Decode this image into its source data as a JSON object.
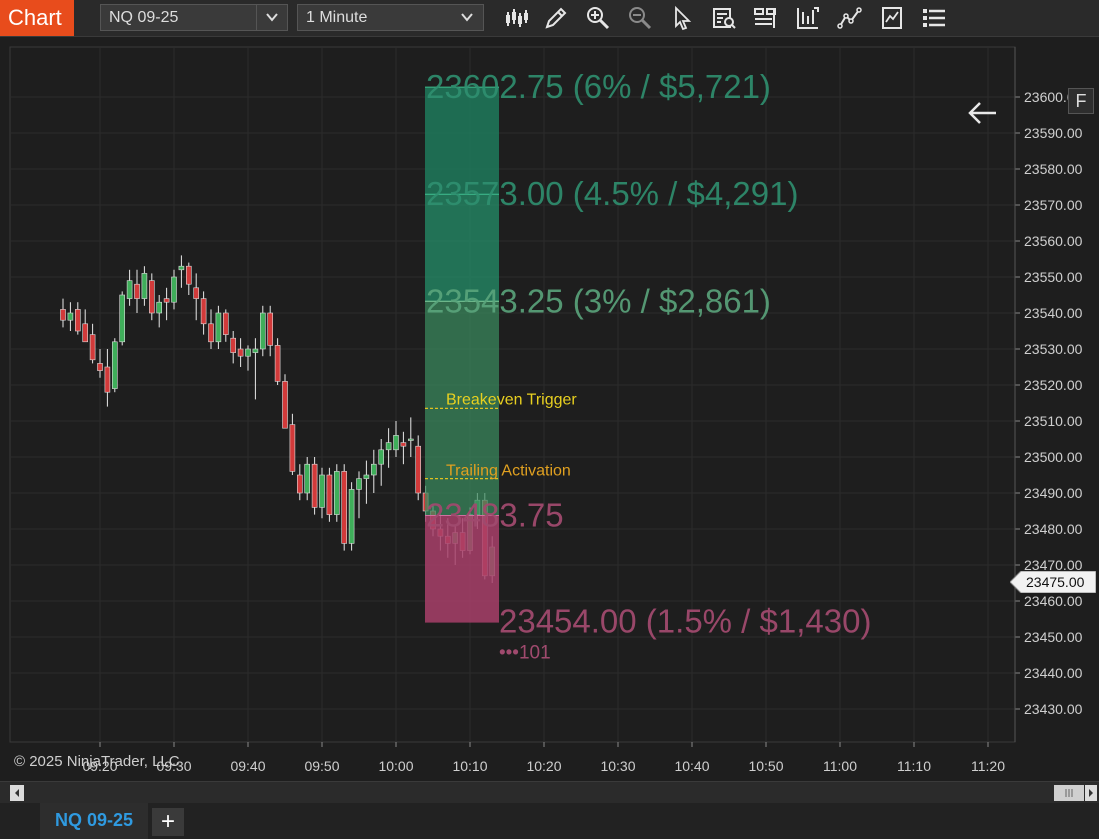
{
  "toolbar": {
    "app_title": "Chart",
    "instrument": "NQ 09-25",
    "interval": "1 Minute",
    "icons": [
      "bar-type-icon",
      "draw-pencil-icon",
      "zoom-in-icon",
      "zoom-out-icon",
      "pointer-icon",
      "data-box-icon",
      "templates-icon",
      "strategies-icon",
      "indicators-icon",
      "properties-icon",
      "list-icon"
    ]
  },
  "chart": {
    "price_axis": [
      "23600.00",
      "23590.00",
      "23580.00",
      "23570.00",
      "23560.00",
      "23550.00",
      "23540.00",
      "23530.00",
      "23520.00",
      "23510.00",
      "23500.00",
      "23490.00",
      "23480.00",
      "23470.00",
      "23460.00",
      "23450.00",
      "23440.00",
      "23430.00"
    ],
    "time_axis": [
      "09:20",
      "09:30",
      "09:40",
      "09:50",
      "10:00",
      "10:10",
      "10:20",
      "10:30",
      "10:40",
      "10:50",
      "11:00",
      "11:10",
      "11:20"
    ],
    "current_price": "23475.00",
    "copyright": "© 2025 NinjaTrader, LLC",
    "f_label": "F",
    "risk_reward": {
      "targets": [
        {
          "label": "23602.75 (6% / $5,721)",
          "price": 23602.75
        },
        {
          "label": "23573.00 (4.5% / $4,291)",
          "price": 23573.0
        },
        {
          "label": "23543.25 (3% / $2,861)",
          "price": 23543.25
        }
      ],
      "entry": {
        "label": "23483.75",
        "price": 23483.75
      },
      "stop": {
        "label": "23454.00 (1.5% / $1,430)",
        "price": 23454.0
      },
      "stop_qty": "•••101",
      "breakeven": {
        "label": "Breakeven Trigger",
        "price": 23513.5
      },
      "trailing": {
        "label": "Trailing Activation",
        "price": 23494.0
      }
    },
    "colors": {
      "background": "#1e1e1e",
      "up_candle": "#3fae5a",
      "down_candle": "#d23a3a",
      "target_zone": "#1f7a5c",
      "stop_zone": "#a8406a",
      "trigger_line": "#e0c020"
    }
  },
  "chart_data": {
    "type": "candlestick",
    "x_unit": "time",
    "y_range": [
      23425,
      23610
    ],
    "candles": [
      {
        "t": "09:15",
        "o": 23541,
        "h": 23544,
        "l": 23536,
        "c": 23538
      },
      {
        "t": "09:16",
        "o": 23538,
        "h": 23543,
        "l": 23535,
        "c": 23540
      },
      {
        "t": "09:17",
        "o": 23541,
        "h": 23543,
        "l": 23534,
        "c": 23535
      },
      {
        "t": "09:18",
        "o": 23537,
        "h": 23541,
        "l": 23532,
        "c": 23532
      },
      {
        "t": "09:19",
        "o": 23534,
        "h": 23537,
        "l": 23526,
        "c": 23527
      },
      {
        "t": "09:20",
        "o": 23526,
        "h": 23530,
        "l": 23522,
        "c": 23524
      },
      {
        "t": "09:21",
        "o": 23525,
        "h": 23530,
        "l": 23514,
        "c": 23518
      },
      {
        "t": "09:22",
        "o": 23519,
        "h": 23533,
        "l": 23518,
        "c": 23532
      },
      {
        "t": "09:23",
        "o": 23532,
        "h": 23546,
        "l": 23531,
        "c": 23545
      },
      {
        "t": "09:24",
        "o": 23544,
        "h": 23552,
        "l": 23542,
        "c": 23549
      },
      {
        "t": "09:25",
        "o": 23548,
        "h": 23552,
        "l": 23540,
        "c": 23544
      },
      {
        "t": "09:26",
        "o": 23544,
        "h": 23553,
        "l": 23542,
        "c": 23551
      },
      {
        "t": "09:27",
        "o": 23549,
        "h": 23551,
        "l": 23538,
        "c": 23540
      },
      {
        "t": "09:28",
        "o": 23540,
        "h": 23545,
        "l": 23536,
        "c": 23543
      },
      {
        "t": "09:29",
        "o": 23544,
        "h": 23547,
        "l": 23538,
        "c": 23543
      },
      {
        "t": "09:30",
        "o": 23543,
        "h": 23552,
        "l": 23541,
        "c": 23550
      },
      {
        "t": "09:31",
        "o": 23552,
        "h": 23556,
        "l": 23547,
        "c": 23553
      },
      {
        "t": "09:32",
        "o": 23553,
        "h": 23554,
        "l": 23545,
        "c": 23548
      },
      {
        "t": "09:33",
        "o": 23547,
        "h": 23551,
        "l": 23538,
        "c": 23544
      },
      {
        "t": "09:34",
        "o": 23544,
        "h": 23546,
        "l": 23534,
        "c": 23537
      },
      {
        "t": "09:35",
        "o": 23537,
        "h": 23541,
        "l": 23530,
        "c": 23532
      },
      {
        "t": "09:36",
        "o": 23532,
        "h": 23542,
        "l": 23530,
        "c": 23540
      },
      {
        "t": "09:37",
        "o": 23540,
        "h": 23541,
        "l": 23532,
        "c": 23534
      },
      {
        "t": "09:38",
        "o": 23533,
        "h": 23535,
        "l": 23526,
        "c": 23529
      },
      {
        "t": "09:39",
        "o": 23530,
        "h": 23533,
        "l": 23525,
        "c": 23528
      },
      {
        "t": "09:40",
        "o": 23528,
        "h": 23531,
        "l": 23524,
        "c": 23530
      },
      {
        "t": "09:41",
        "o": 23529,
        "h": 23533,
        "l": 23516,
        "c": 23530
      },
      {
        "t": "09:42",
        "o": 23530,
        "h": 23542,
        "l": 23528,
        "c": 23540
      },
      {
        "t": "09:43",
        "o": 23540,
        "h": 23542,
        "l": 23528,
        "c": 23531
      },
      {
        "t": "09:44",
        "o": 23531,
        "h": 23533,
        "l": 23520,
        "c": 23521
      },
      {
        "t": "09:45",
        "o": 23521,
        "h": 23523,
        "l": 23508,
        "c": 23508
      },
      {
        "t": "09:46",
        "o": 23509,
        "h": 23512,
        "l": 23495,
        "c": 23496
      },
      {
        "t": "09:47",
        "o": 23495,
        "h": 23498,
        "l": 23488,
        "c": 23490
      },
      {
        "t": "09:48",
        "o": 23490,
        "h": 23500,
        "l": 23488,
        "c": 23498
      },
      {
        "t": "09:49",
        "o": 23498,
        "h": 23500,
        "l": 23484,
        "c": 23486
      },
      {
        "t": "09:50",
        "o": 23486,
        "h": 23497,
        "l": 23483,
        "c": 23495
      },
      {
        "t": "09:51",
        "o": 23495,
        "h": 23497,
        "l": 23482,
        "c": 23484
      },
      {
        "t": "09:52",
        "o": 23484,
        "h": 23498,
        "l": 23482,
        "c": 23496
      },
      {
        "t": "09:53",
        "o": 23496,
        "h": 23498,
        "l": 23474,
        "c": 23476
      },
      {
        "t": "09:54",
        "o": 23476,
        "h": 23493,
        "l": 23474,
        "c": 23491
      },
      {
        "t": "09:55",
        "o": 23491,
        "h": 23496,
        "l": 23483,
        "c": 23494
      },
      {
        "t": "09:56",
        "o": 23494,
        "h": 23499,
        "l": 23487,
        "c": 23495
      },
      {
        "t": "09:57",
        "o": 23495,
        "h": 23502,
        "l": 23490,
        "c": 23498
      },
      {
        "t": "09:58",
        "o": 23498,
        "h": 23505,
        "l": 23492,
        "c": 23502
      },
      {
        "t": "09:59",
        "o": 23502,
        "h": 23508,
        "l": 23497,
        "c": 23504
      },
      {
        "t": "10:00",
        "o": 23502,
        "h": 23510,
        "l": 23500,
        "c": 23506
      },
      {
        "t": "10:01",
        "o": 23504,
        "h": 23507,
        "l": 23498,
        "c": 23503
      },
      {
        "t": "10:02",
        "o": 23505,
        "h": 23511,
        "l": 23500,
        "c": 23505
      },
      {
        "t": "10:03",
        "o": 23503,
        "h": 23506,
        "l": 23488,
        "c": 23490
      },
      {
        "t": "10:04",
        "o": 23490,
        "h": 23492,
        "l": 23482,
        "c": 23485
      },
      {
        "t": "10:05",
        "o": 23485,
        "h": 23487,
        "l": 23478,
        "c": 23480
      },
      {
        "t": "10:06",
        "o": 23480,
        "h": 23484,
        "l": 23474,
        "c": 23478
      },
      {
        "t": "10:07",
        "o": 23478,
        "h": 23483,
        "l": 23472,
        "c": 23476
      },
      {
        "t": "10:08",
        "o": 23476,
        "h": 23481,
        "l": 23470,
        "c": 23479
      },
      {
        "t": "10:09",
        "o": 23479,
        "h": 23483,
        "l": 23472,
        "c": 23474
      },
      {
        "t": "10:10",
        "o": 23474,
        "h": 23486,
        "l": 23473,
        "c": 23484
      },
      {
        "t": "10:11",
        "o": 23484,
        "h": 23490,
        "l": 23480,
        "c": 23488
      },
      {
        "t": "10:12",
        "o": 23488,
        "h": 23490,
        "l": 23466,
        "c": 23467
      },
      {
        "t": "10:13",
        "o": 23467,
        "h": 23478,
        "l": 23465,
        "c": 23475
      }
    ]
  }
}
